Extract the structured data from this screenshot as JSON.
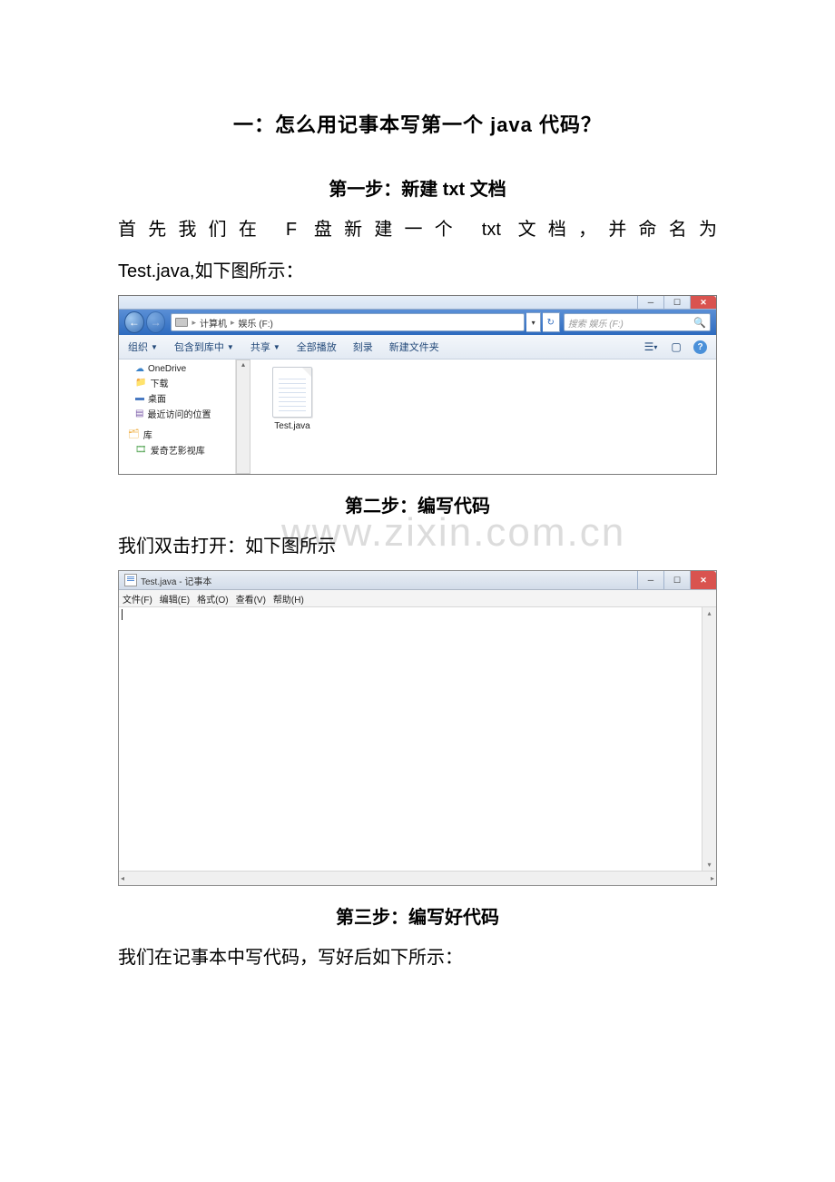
{
  "title": "一：怎么用记事本写第一个 java 代码？",
  "step1": {
    "heading": "第一步：新建 txt 文档",
    "line1": "首先我们在 F 盘新建一个 txt 文档，并命名为",
    "line2": "Test.java,如下图所示："
  },
  "step2": {
    "heading": "第二步：编写代码",
    "text": "我们双击打开：如下图所示"
  },
  "step3": {
    "heading": "第三步：编写好代码",
    "text": "我们在记事本中写代码，写好后如下所示："
  },
  "watermark": "www.zixin.com.cn",
  "explorer": {
    "breadcrumb": [
      "计算机",
      "娱乐 (F:)"
    ],
    "search_placeholder": "搜索 娱乐 (F:)",
    "toolbar": {
      "organize": "组织",
      "include": "包含到库中",
      "share": "共享",
      "play_all": "全部播放",
      "burn": "刻录",
      "new_folder": "新建文件夹"
    },
    "sidebar": {
      "onedrive": "OneDrive",
      "downloads": "下载",
      "desktop": "桌面",
      "recent": "最近访问的位置",
      "libraries": "库",
      "iqiyi": "爱奇艺影视库"
    },
    "file": {
      "name": "Test.java"
    }
  },
  "notepad": {
    "title": "Test.java - 记事本",
    "menu": {
      "file": "文件(F)",
      "edit": "编辑(E)",
      "format": "格式(O)",
      "view": "查看(V)",
      "help": "帮助(H)"
    }
  }
}
